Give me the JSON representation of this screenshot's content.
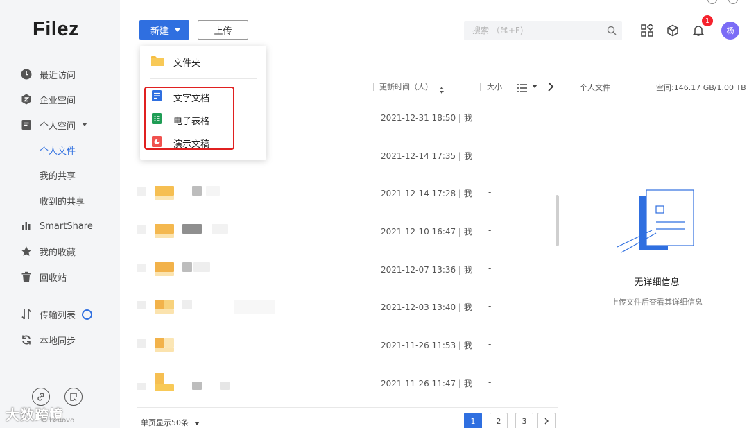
{
  "sidebar": {
    "logo": "Filez",
    "items": [
      {
        "label": "最近访问",
        "icon": "clock-icon"
      },
      {
        "label": "企业空间",
        "icon": "enterprise-icon"
      },
      {
        "label": "个人空间",
        "icon": "personal-space-icon"
      },
      {
        "label": "个人文件"
      },
      {
        "label": "我的共享"
      },
      {
        "label": "收到的共享"
      },
      {
        "label": "SmartShare",
        "icon": "bar-chart-icon"
      },
      {
        "label": "我的收藏",
        "icon": "star-icon"
      },
      {
        "label": "回收站",
        "icon": "trash-icon"
      },
      {
        "label": "传输列表",
        "icon": "transfer-icon"
      },
      {
        "label": "本地同步",
        "icon": "sync-icon"
      }
    ],
    "watermark": "大数跨境",
    "watermark_sub": "© Lenovo"
  },
  "toolbar": {
    "new_label": "新建",
    "upload_label": "上传",
    "search_placeholder": "搜索 （⌘+F)",
    "notification_count": "1",
    "avatar_text": "杨"
  },
  "new_menu": {
    "items": [
      {
        "label": "文件夹",
        "icon": "folder-icon"
      },
      {
        "label": "文字文档",
        "icon": "document-icon"
      },
      {
        "label": "电子表格",
        "icon": "spreadsheet-icon"
      },
      {
        "label": "演示文稿",
        "icon": "presentation-icon"
      }
    ]
  },
  "table": {
    "col_updated": "更新时间（人）",
    "col_size": "大小",
    "rows": [
      {
        "updated": "2021-12-31 18:50 | 我",
        "size": "-"
      },
      {
        "updated": "2021-12-14 17:35 | 我",
        "size": "-"
      },
      {
        "updated": "2021-12-14 17:28 | 我",
        "size": "-"
      },
      {
        "updated": "2021-12-10 16:47 | 我",
        "size": "-"
      },
      {
        "updated": "2021-12-07 13:36 | 我",
        "size": "-"
      },
      {
        "updated": "2021-12-03 13:40 | 我",
        "size": "-"
      },
      {
        "updated": "2021-11-26 11:53 | 我",
        "size": "-"
      },
      {
        "updated": "2021-11-26 11:47 | 我",
        "size": "-"
      }
    ]
  },
  "pagination": {
    "per_page": "单页显示50条",
    "pages": [
      "1",
      "2",
      "3"
    ],
    "current": "1"
  },
  "detail_panel": {
    "title": "个人文件",
    "space": "空间:146.17 GB/1.00 TB",
    "empty_title": "无详细信息",
    "empty_sub": "上传文件后查看其详细信息"
  },
  "colors": {
    "accent": "#2f6fe0",
    "sidebar_bg": "#f4f5f7",
    "highlight": "#e02020",
    "badge": "#f5222d",
    "avatar": "#7b6cf6"
  }
}
